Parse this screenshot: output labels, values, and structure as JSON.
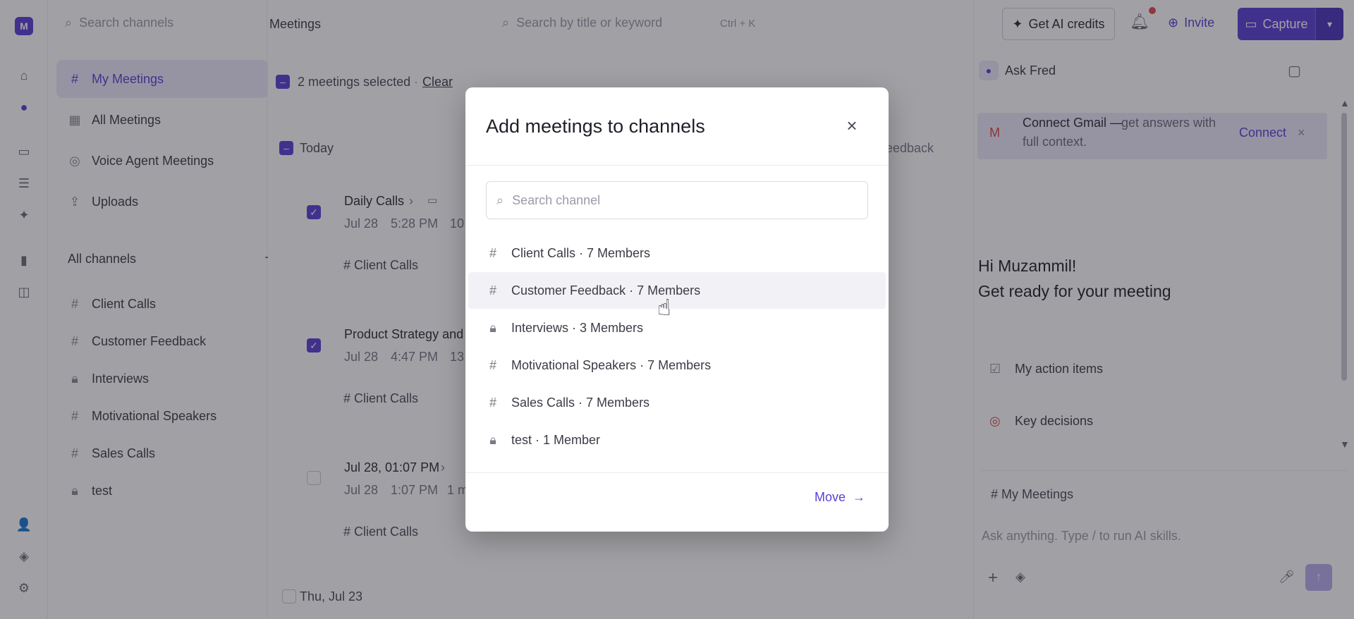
{
  "rail": {
    "logo": "M"
  },
  "sidebar": {
    "search_placeholder": "Search channels",
    "nav": [
      {
        "label": "My Meetings"
      },
      {
        "label": "All Meetings"
      },
      {
        "label": "Voice Agent Meetings"
      },
      {
        "label": "Uploads"
      }
    ],
    "channels_header": "All channels",
    "channels": [
      {
        "label": "Client Calls",
        "icon": "hash"
      },
      {
        "label": "Customer Feedback",
        "icon": "hash"
      },
      {
        "label": "Interviews",
        "icon": "lock"
      },
      {
        "label": "Motivational Speakers",
        "icon": "hash"
      },
      {
        "label": "Sales Calls",
        "icon": "hash"
      },
      {
        "label": "test",
        "icon": "lock"
      }
    ]
  },
  "header": {
    "title": "Meetings",
    "search_placeholder": "Search by title or keyword",
    "shortcut": "Ctrl + K",
    "ai_credits": "Get AI credits",
    "invite": "Invite",
    "capture": "Capture"
  },
  "main": {
    "selection_text": "2 meetings selected",
    "clear": "Clear",
    "group_today": "Today",
    "group_thu": "Thu, Jul 23",
    "meetings": [
      {
        "title": "Daily Calls",
        "date": "Jul 28",
        "time": "5:28 PM",
        "extra": "10",
        "channel": "# Client Calls"
      },
      {
        "title": "Product Strategy and",
        "date": "Jul 28",
        "time": "4:47 PM",
        "extra": "13",
        "channel": "# Client Calls"
      },
      {
        "title": "Jul 28, 01:07 PM",
        "date": "Jul 28",
        "time": "1:07 PM",
        "extra": "1 m",
        "channel": "# Client Calls"
      }
    ],
    "peek_text": "eedback"
  },
  "right": {
    "ask_label": "Ask Fred",
    "gmail_title": "Connect Gmail —",
    "gmail_rest": "get answers with",
    "gmail_line2": "full context.",
    "connect": "Connect",
    "greeting": "Hi Muzammil!",
    "greeting_sub": "Get ready for your meeting",
    "action_items": "My action items",
    "key_decisions": "Key decisions",
    "channel_tag": "# My Meetings",
    "input_placeholder": "Ask anything. Type / to run AI skills."
  },
  "modal": {
    "title": "Add meetings to channels",
    "search_placeholder": "Search channel",
    "channels": [
      {
        "label": "Client Calls · 7 Members",
        "icon": "hash"
      },
      {
        "label": "Customer Feedback · 7 Members",
        "icon": "hash"
      },
      {
        "label": "Interviews · 3 Members",
        "icon": "lock"
      },
      {
        "label": "Motivational Speakers · 7 Members",
        "icon": "hash"
      },
      {
        "label": "Sales Calls · 7 Members",
        "icon": "hash"
      },
      {
        "label": "test · 1 Member",
        "icon": "lock"
      }
    ],
    "move": "Move"
  },
  "colors": {
    "accent": "#5b3fd6",
    "overlay": "rgba(30,30,40,0.42)"
  }
}
